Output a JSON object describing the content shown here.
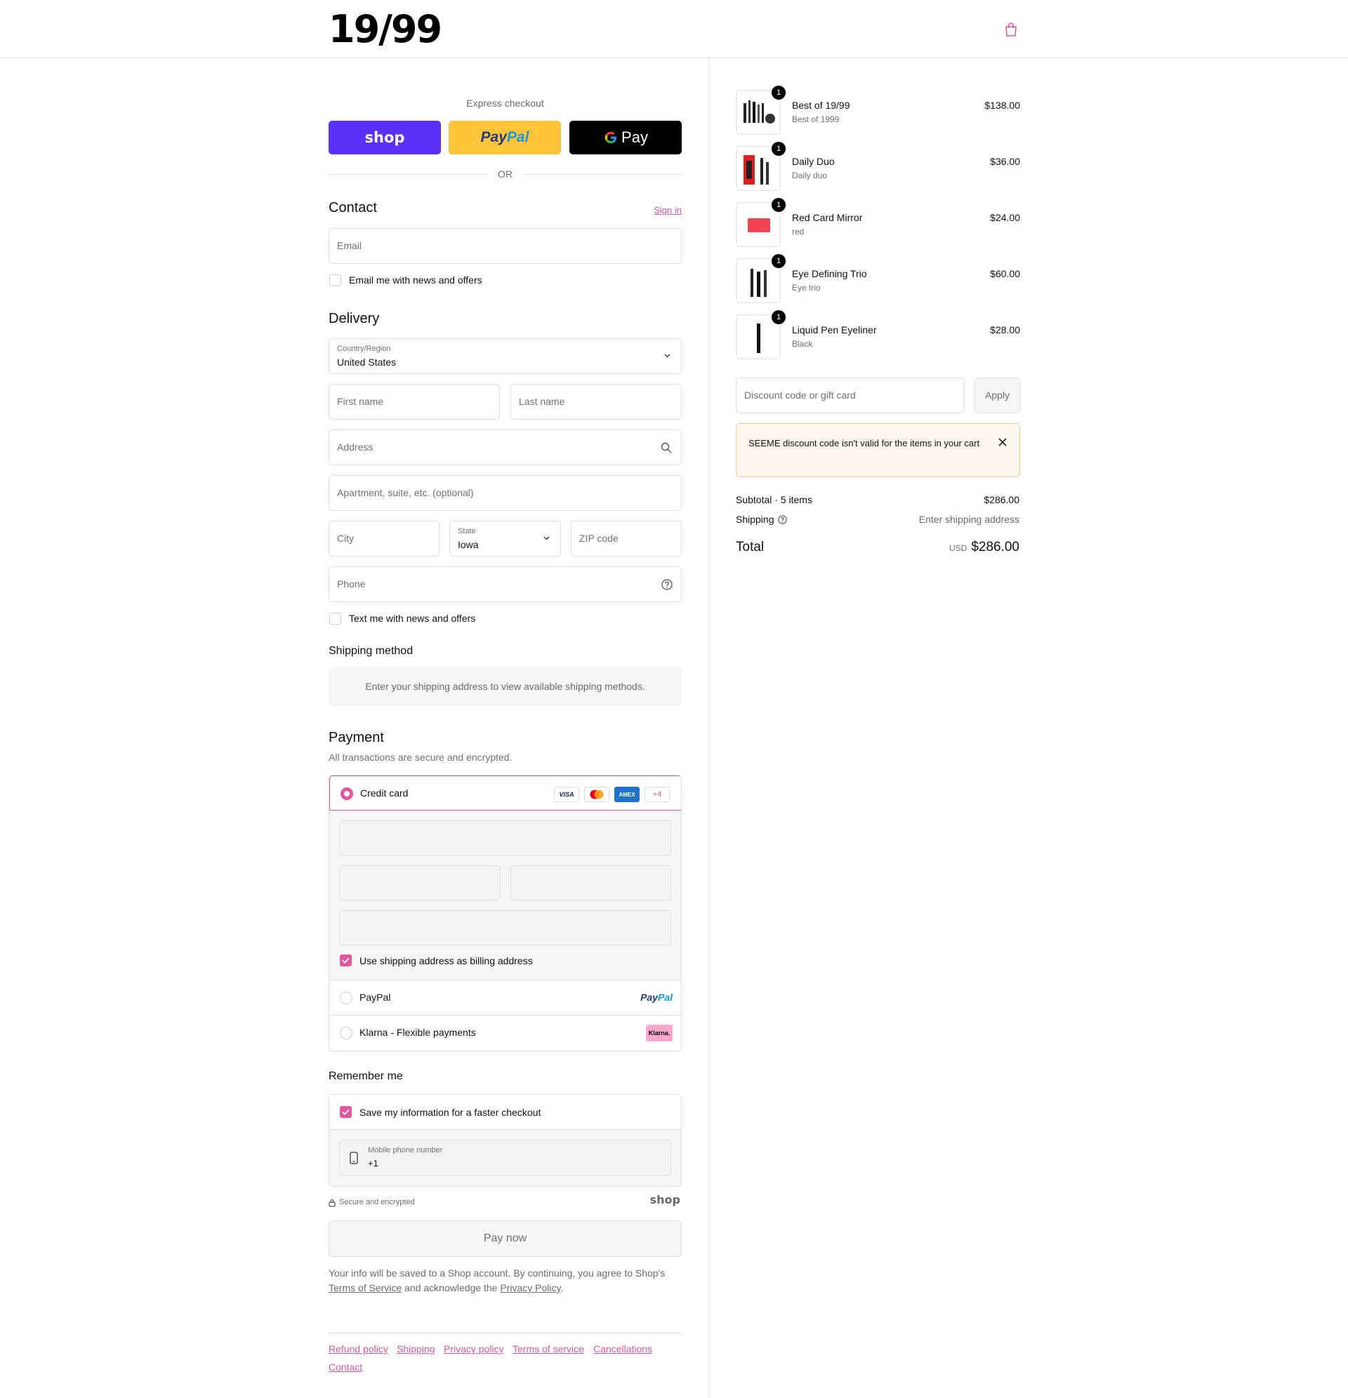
{
  "header": {
    "logo": "19/99"
  },
  "express": {
    "title": "Express checkout",
    "shop_label": "shop",
    "paypal_label_a": "Pay",
    "paypal_label_b": "Pal",
    "gpay_label": "Pay",
    "or": "OR"
  },
  "contact": {
    "title": "Contact",
    "sign_in": "Sign in",
    "email_placeholder": "Email",
    "news_label": "Email me with news and offers"
  },
  "delivery": {
    "title": "Delivery",
    "country_label": "Country/Region",
    "country_value": "United States",
    "first_name": "First name",
    "last_name": "Last name",
    "address": "Address",
    "apartment": "Apartment, suite, etc. (optional)",
    "city": "City",
    "state_label": "State",
    "state_value": "Iowa",
    "zip": "ZIP code",
    "phone": "Phone",
    "text_label": "Text me with news and offers"
  },
  "shipping_method": {
    "title": "Shipping method",
    "message": "Enter your shipping address to view available shipping methods."
  },
  "payment": {
    "title": "Payment",
    "subtitle": "All transactions are secure and encrypted.",
    "credit_card": "Credit card",
    "visa": "VISA",
    "amex": "AMEX",
    "more": "+4",
    "billing_label": "Use shipping address as billing address",
    "paypal": "PayPal",
    "paypal_logo_a": "Pay",
    "paypal_logo_b": "Pal",
    "klarna": "Klarna - Flexible payments",
    "klarna_logo": "Klarna."
  },
  "remember": {
    "title": "Remember me",
    "save_label": "Save my information for a faster checkout",
    "phone_label": "Mobile phone number",
    "phone_value": "+1"
  },
  "secure": {
    "label": "Secure and encrypted",
    "shop": "shop"
  },
  "pay_now": "Pay now",
  "legal": {
    "line1": "Your info will be saved to a Shop account. By continuing, you agree to Shop's",
    "terms": "Terms of Service",
    "and": " and acknowledge the ",
    "privacy": "Privacy Policy",
    "end": "."
  },
  "footer": {
    "links": [
      "Refund policy",
      "Shipping",
      "Privacy policy",
      "Terms of service",
      "Cancellations",
      "Contact"
    ]
  },
  "cart": {
    "items": [
      {
        "name": "Best of 19/99",
        "variant": "Best of 1999",
        "price": "$138.00",
        "qty": "1"
      },
      {
        "name": "Daily Duo",
        "variant": "Daily duo",
        "price": "$36.00",
        "qty": "1"
      },
      {
        "name": "Red Card Mirror",
        "variant": "red",
        "price": "$24.00",
        "qty": "1"
      },
      {
        "name": "Eye Defining Trio",
        "variant": "Eye trio",
        "price": "$60.00",
        "qty": "1"
      },
      {
        "name": "Liquid Pen Eyeliner",
        "variant": "Black",
        "price": "$28.00",
        "qty": "1"
      }
    ],
    "discount_placeholder": "Discount code or gift card",
    "apply": "Apply",
    "error": "SEEME discount code isn't valid for the items in your cart",
    "subtotal_label": "Subtotal · 5 items",
    "subtotal_value": "$286.00",
    "shipping_label": "Shipping",
    "shipping_value": "Enter shipping address",
    "total_label": "Total",
    "currency": "USD",
    "total_value": "$286.00"
  },
  "colors": {
    "accent": "#e2559f",
    "shop": "#5a31f4",
    "paypal": "#ffc439",
    "gpay": "#000000"
  }
}
